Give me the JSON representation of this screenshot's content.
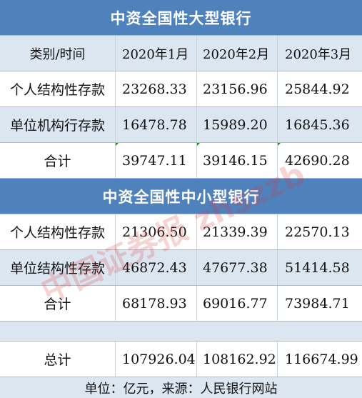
{
  "section1": {
    "title": "中资全国性大型银行",
    "header": [
      "类别/时间",
      "2020年1月",
      "2020年2月",
      "2020年3月"
    ],
    "rows": [
      {
        "label": "个人结构性存款",
        "values": [
          "23268.33",
          "23156.96",
          "25844.92"
        ]
      },
      {
        "label": "单位机构行存款",
        "values": [
          "16478.78",
          "15989.20",
          "16845.36"
        ]
      },
      {
        "label": "合计",
        "values": [
          "39747.11",
          "39146.15",
          "42690.28"
        ]
      }
    ]
  },
  "section2": {
    "title": "中资全国性中小型银行",
    "rows": [
      {
        "label": "个人结构性存款",
        "values": [
          "21306.50",
          "21339.39",
          "22570.13"
        ]
      },
      {
        "label": "单位结构性存款",
        "values": [
          "46872.43",
          "47677.38",
          "51414.58"
        ]
      },
      {
        "label": "合计",
        "values": [
          "68178.93",
          "69016.77",
          "73984.71"
        ]
      }
    ]
  },
  "total": {
    "label": "总计",
    "values": [
      "107926.04",
      "108162.92",
      "116674.99"
    ]
  },
  "footer": "单位：亿元，来源：人民银行网站",
  "watermark": "中国证券报 zhszzb",
  "colors": {
    "title_bg": "#4f81bd",
    "band": "#dce6f1",
    "border": "#a9bcd6"
  }
}
